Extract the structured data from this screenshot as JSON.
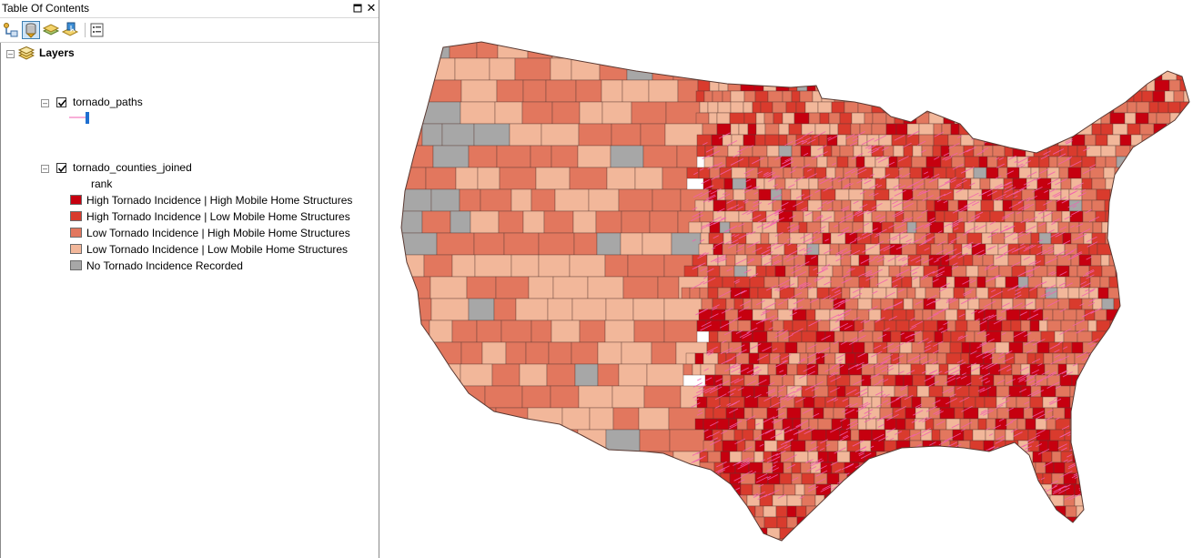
{
  "toc": {
    "title": "Table Of Contents",
    "close_glyph": "✕",
    "root_label": "Layers",
    "layers": [
      {
        "name": "tornado_paths",
        "checked": true,
        "line_color": "#f25fb1"
      },
      {
        "name": "tornado_counties_joined",
        "checked": true,
        "field": "rank",
        "classes": [
          {
            "label": "High Tornado Incidence | High Mobile Home Structures",
            "color": "#c6000f"
          },
          {
            "label": "High Tornado Incidence | Low Mobile Home Structures",
            "color": "#d93b2d"
          },
          {
            "label": "Low Tornado Incidence | High Mobile Home Structures",
            "color": "#e2775e"
          },
          {
            "label": "Low Tornado Incidence | Low Mobile Home Structures",
            "color": "#f2b79a"
          },
          {
            "label": "No Tornado Incidence Recorded",
            "color": "#a7a7a7"
          }
        ]
      }
    ]
  },
  "toolbar": {
    "icons": [
      "list-by-drawing-order-icon",
      "list-by-source-icon",
      "list-by-visibility-icon",
      "list-by-selection-icon",
      "options-icon"
    ]
  },
  "map": {
    "background": "#ffffff",
    "county_border_color": "#5a3a33"
  }
}
